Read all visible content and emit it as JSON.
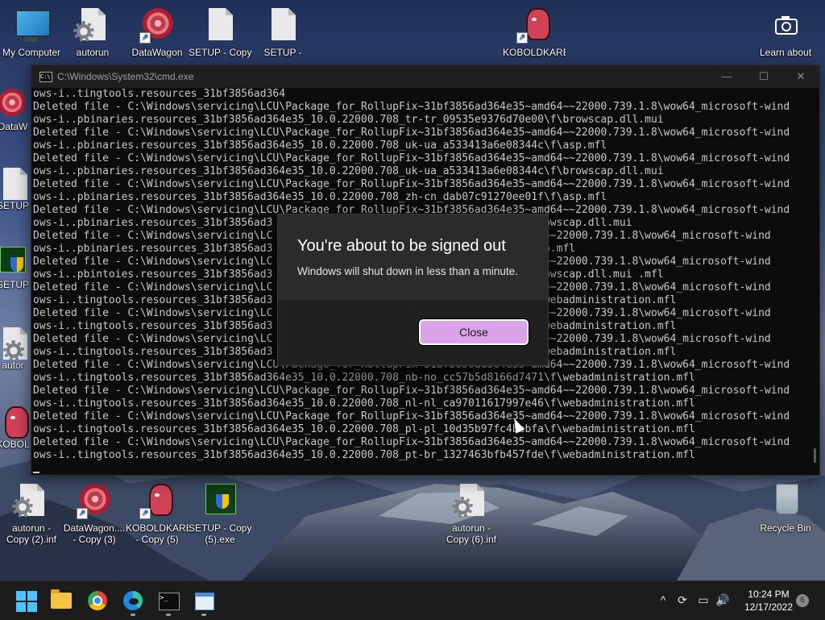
{
  "desktop": {
    "icons_top": [
      {
        "label": "My Computer",
        "name": "desktop-icon-my-computer"
      },
      {
        "label": "autorun",
        "name": "desktop-icon-autorun"
      },
      {
        "label": "DataWagon",
        "name": "desktop-icon-datawagon"
      },
      {
        "label": "SETUP - Copy",
        "name": "desktop-icon-setup-copy"
      },
      {
        "label": "SETUP -",
        "name": "desktop-icon-setup"
      },
      {
        "label": "KOBOLDKARE",
        "name": "desktop-icon-koboldkare"
      },
      {
        "label": "Learn about",
        "name": "desktop-icon-learn-about"
      }
    ],
    "icons_left_partial": [
      "DataW",
      "SETUP",
      "SETUP",
      "autor",
      "KOBOL"
    ],
    "icons_bottom": [
      {
        "label1": "autorun -",
        "label2": "Copy (2).inf"
      },
      {
        "label1": "DataWagon....",
        "label2": "- Copy (3)"
      },
      {
        "label1": "KOBOLDKARE",
        "label2": "- Copy (5)"
      },
      {
        "label1": "SETUP - Copy",
        "label2": "(5).exe"
      },
      {
        "label1": "autorun -",
        "label2": "Copy (6).inf"
      },
      {
        "label1": "Recycle Bin",
        "label2": ""
      }
    ]
  },
  "cmd_window": {
    "title": "C:\\Windows\\System32\\cmd.exe",
    "minimize": "—",
    "maximize": "☐",
    "close": "✕",
    "lines": [
      "ows-i..tingtools.resources_31bf3856ad364",
      "Deleted file - C:\\Windows\\servicing\\LCU\\Package_for_RollupFix~31bf3856ad364e35~amd64~~22000.739.1.8\\wow64_microsoft-wind",
      "ows-i..pbinaries.resources_31bf3856ad364e35_10.0.22000.708_tr-tr_09535e9376d70e00\\f\\browscap.dll.mui",
      "Deleted file - C:\\Windows\\servicing\\LCU\\Package_for_RollupFix~31bf3856ad364e35~amd64~~22000.739.1.8\\wow64_microsoft-wind",
      "ows-i..pbinaries.resources_31bf3856ad364e35_10.0.22000.708_uk-ua_a533413a6e08344c\\f\\asp.mfl",
      "Deleted file - C:\\Windows\\servicing\\LCU\\Package_for_RollupFix~31bf3856ad364e35~amd64~~22000.739.1.8\\wow64_microsoft-wind",
      "ows-i..pbinaries.resources_31bf3856ad364e35_10.0.22000.708_uk-ua_a533413a6e08344c\\f\\browscap.dll.mui",
      "Deleted file - C:\\Windows\\servicing\\LCU\\Package_for_RollupFix~31bf3856ad364e35~amd64~~22000.739.1.8\\wow64_microsoft-wind",
      "ows-i..pbinaries.resources_31bf3856ad364e35_10.0.22000.708_zh-cn_dab07c91270ee01f\\f\\asp.mfl",
      "Deleted file - C:\\Windows\\servicing\\LCU\\Package_for_RollupFix~31bf3856ad364e35~amd64~~22000.739.1.8\\wow64_microsoft-wind",
      "ows-i..pbinaries.resources_31bf3856ad3                                       f\\browscap.dll.mui",
      "Deleted file - C:\\Windows\\servicing\\LC                                     ~amd64~~22000.739.1.8\\wow64_microsoft-wind",
      "ows-i..pbinaries.resources_31bf3856ad3                                       f\\asp.mfl",
      "Deleted file - C:\\Windows\\servicing\\LC                                     ~amd64~~22000.739.1.8\\wow64_microsoft-wind",
      "ows-i..pbintoies.resources_31bf3856ad3                                       f\\browscap.dll.mui .mfl",
      "Deleted file - C:\\Windows\\servicing\\LC                                     ~amd64~~22000.739.1.8\\wow64_microsoft-wind",
      "ows-i..tingtools.resources_31bf3856ad3                                       5\\f\\webadministration.mfl",
      "Deleted file - C:\\Windows\\servicing\\LC                                     ~amd64~~22000.739.1.8\\wow64_microsoft-wind",
      "ows-i..tingtools.resources_31bf3856ad3                                       2\\f\\webadministration.mfl",
      "Deleted file - C:\\Windows\\servicing\\LC                                     ~amd64~~22000.739.1.8\\wow64_microsoft-wind",
      "ows-i..tingtools.resources_31bf3856ad3                                       2\\f\\webadministration.mfl",
      "Deleted file - C:\\Windows\\servicing\\LCU\\Package_for_RollupFix~31bf3856ad364e35~amd64~~22000.739.1.8\\wow64_microsoft-wind",
      "ows-i..tingtools.resources_31bf3856ad364e35_10.0.22000.708_nb-no_cc57b5d8166d7471\\f\\webadministration.mfl",
      "Deleted file - C:\\Windows\\servicing\\LCU\\Package_for_RollupFix~31bf3856ad364e35~amd64~~22000.739.1.8\\wow64_microsoft-wind",
      "ows-i..tingtools.resources_31bf3856ad364e35_10.0.22000.708_nl-nl_ca97011617997e46\\f\\webadministration.mfl",
      "Deleted file - C:\\Windows\\servicing\\LCU\\Package_for_RollupFix~31bf3856ad364e35~amd64~~22000.739.1.8\\wow64_microsoft-wind",
      "ows-i..tingtools.resources_31bf3856ad364e35_10.0.22000.708_pl-pl_10d35b97fc4bebfa\\f\\webadministration.mfl",
      "Deleted file - C:\\Windows\\servicing\\LCU\\Package_for_RollupFix~31bf3856ad364e35~amd64~~22000.739.1.8\\wow64_microsoft-wind",
      "ows-i..tingtools.resources_31bf3856ad364e35_10.0.22000.708_pt-br_1327463bfb457fde\\f\\webadministration.mfl"
    ]
  },
  "dialog": {
    "title": "You're about to be signed out",
    "message": "Windows will shut down in less than a minute.",
    "close_label": "Close"
  },
  "taskbar": {
    "apps": [
      "start",
      "file-explorer",
      "chrome",
      "edge",
      "command-prompt",
      "notepad"
    ],
    "tray": {
      "chevron": "^",
      "sync": "⟳",
      "network": "▭",
      "volume": "🔊"
    },
    "clock": {
      "time": "10:24 PM",
      "date": "12/17/2022"
    },
    "notifications": "6"
  },
  "colors": {
    "dialog_button": "#dba3ea",
    "cmd_text": "#c8c8c8",
    "taskbar": "#1c1c1c"
  }
}
